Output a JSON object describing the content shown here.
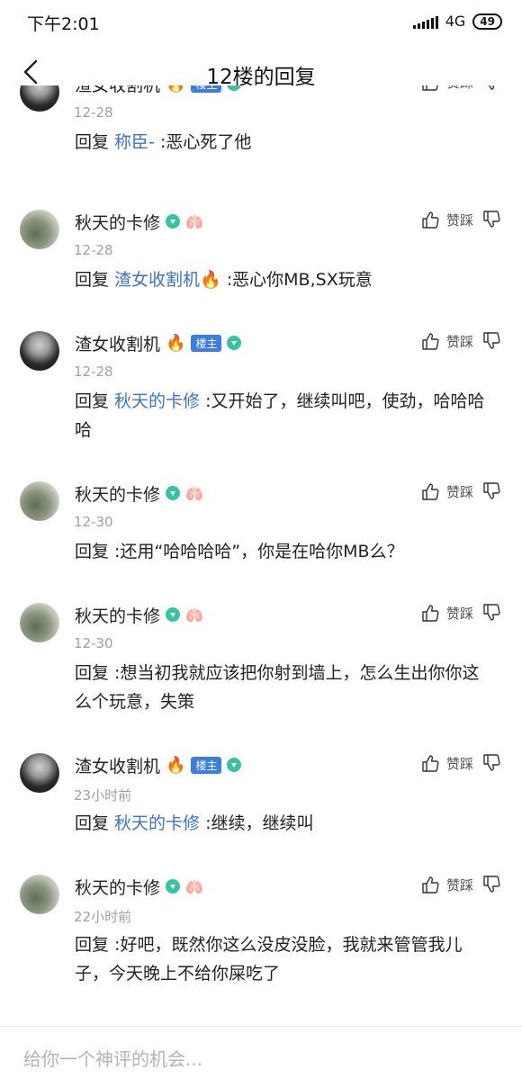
{
  "status_bar": {
    "time": "下午2:01",
    "network": "4G",
    "battery": "49"
  },
  "nav": {
    "title": "12楼的回复"
  },
  "comments": [
    {
      "user": "渣女收割机",
      "has_host_badge": true,
      "time": "12-28",
      "reply_prefix": "回复 ",
      "mention": "称臣-",
      "text": " :恶心死了他"
    },
    {
      "user": "秋天的卡修",
      "has_host_badge": false,
      "time": "12-28",
      "reply_prefix": "回复 ",
      "mention": "渣女收割机🔥",
      "text": " :恶心你MB,SX玩意"
    },
    {
      "user": "渣女收割机",
      "has_host_badge": true,
      "time": "12-28",
      "reply_prefix": "回复 ",
      "mention": "秋天的卡修",
      "text": " :又开始了，继续叫吧，使劲，哈哈哈哈"
    },
    {
      "user": "秋天的卡修",
      "has_host_badge": false,
      "time": "12-30",
      "reply_prefix": "回复",
      "mention": "",
      "text": " :还用“哈哈哈哈”，你是在哈你MB么？"
    },
    {
      "user": "秋天的卡修",
      "has_host_badge": false,
      "time": "12-30",
      "reply_prefix": "回复",
      "mention": "",
      "text": " :想当初我就应该把你射到墙上，怎么生出你你这么个玩意，失策"
    },
    {
      "user": "渣女收割机",
      "has_host_badge": true,
      "time": "23小时前",
      "reply_prefix": "回复 ",
      "mention": "秋天的卡修",
      "text": " :继续，继续叫"
    },
    {
      "user": "秋天的卡修",
      "has_host_badge": false,
      "time": "22小时前",
      "reply_prefix": "回复",
      "mention": "",
      "text": " :好吧，既然你这么没皮没脸，我就来管管我儿子，今天晚上不给你屎吃了"
    }
  ],
  "labels": {
    "host_badge": "楼主",
    "like_dislike": "赞踩",
    "fire": "🔥",
    "lungs": "🫁"
  },
  "reply_bar": {
    "placeholder": "给你一个神评的机会..."
  },
  "icons": {
    "back": "chevron-left-icon",
    "like": "thumb-up-icon",
    "dislike": "thumb-down-icon",
    "gem": "gem-icon"
  },
  "colors": {
    "mention": "#3a74c9",
    "host_badge": "#3b7de0",
    "gem": "#35c4a0"
  }
}
